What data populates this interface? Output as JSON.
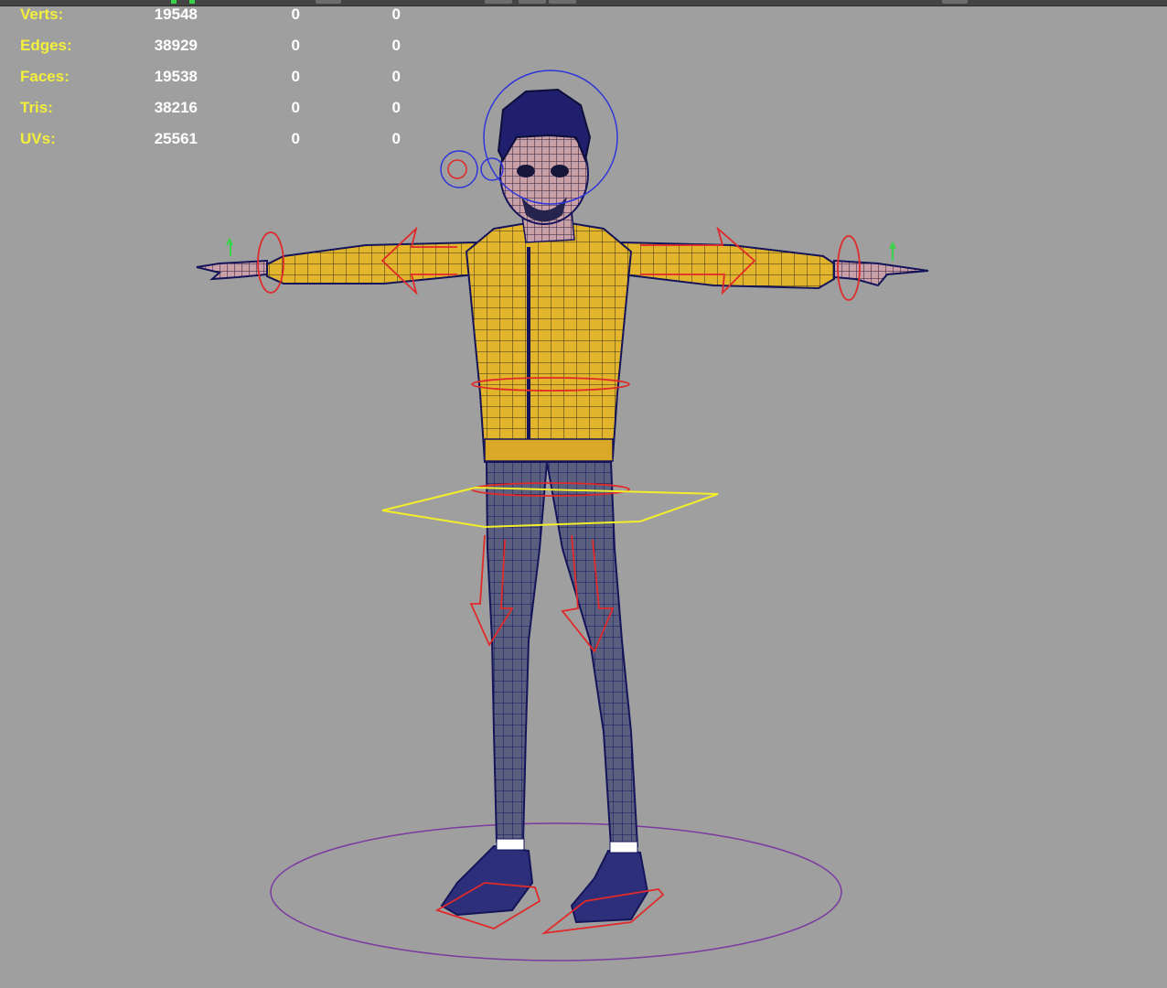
{
  "hud": {
    "rows": [
      {
        "label": "Verts:",
        "value": "19548",
        "selected": "0",
        "uv": "0"
      },
      {
        "label": "Edges:",
        "value": "38929",
        "selected": "0",
        "uv": "0"
      },
      {
        "label": "Faces:",
        "value": "19538",
        "selected": "0",
        "uv": "0"
      },
      {
        "label": "Tris:",
        "value": "38216",
        "selected": "0",
        "uv": "0"
      },
      {
        "label": "UVs:",
        "value": "25561",
        "selected": "0",
        "uv": "0"
      }
    ]
  },
  "colors": {
    "viewport_bg": "#9f9f9f",
    "hud_label": "#f3ef3b",
    "hud_value": "#ffffff",
    "jacket": "#e2b52c",
    "wireframe": "#1a1a6e",
    "control_red": "#e02a2a",
    "control_blue": "#2f36d8",
    "control_yellow": "#f2ee2a",
    "ground_circle": "#7a3aa0"
  }
}
